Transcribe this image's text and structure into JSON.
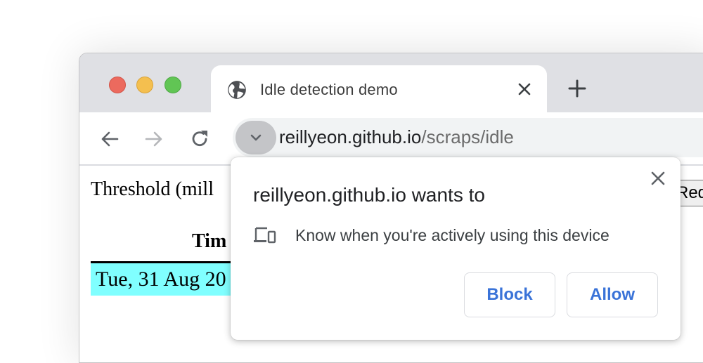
{
  "browser": {
    "tab": {
      "title": "Idle detection demo",
      "favicon": "globe-icon",
      "close_icon": "close-icon"
    },
    "new_tab_icon": "plus-icon",
    "toolbar": {
      "back_icon": "arrow-left-icon",
      "forward_icon": "arrow-right-icon",
      "reload_icon": "reload-icon",
      "chip_icon": "chevron-down-icon"
    },
    "omnibox": {
      "host": "reillyeon.github.io",
      "path": "/scraps/idle"
    },
    "window_controls": [
      "close",
      "minimize",
      "zoom"
    ]
  },
  "page": {
    "threshold_label": "Threshold (mill",
    "request_button_label": "Request",
    "table": {
      "header": "Tim",
      "rows": [
        "Tue, 31 Aug 20"
      ],
      "row_color": "#80ffff"
    }
  },
  "permission_prompt": {
    "title": "reillyeon.github.io wants to",
    "permission_icon": "devices-icon",
    "permission_text": "Know when you're actively using this device",
    "block_label": "Block",
    "allow_label": "Allow",
    "close_icon": "close-icon",
    "accent_color": "#1a73e8"
  }
}
